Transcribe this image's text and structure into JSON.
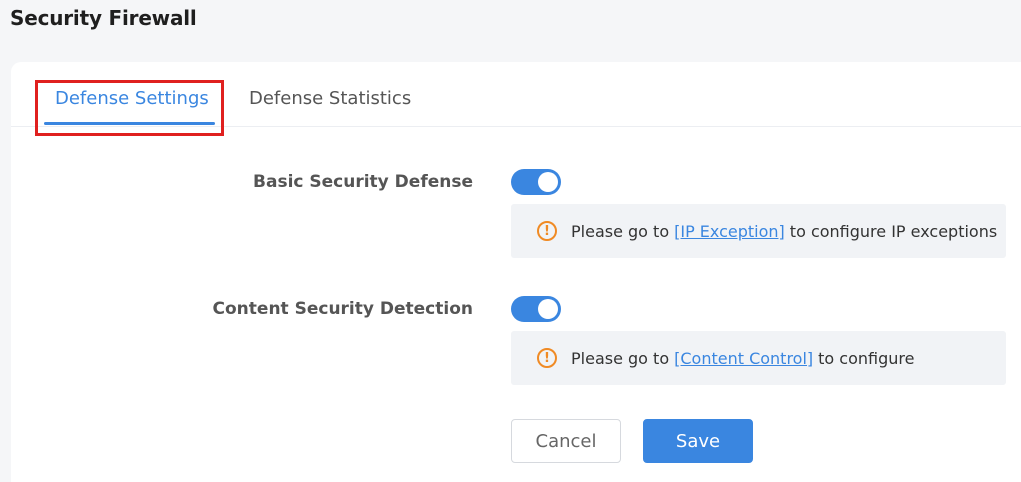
{
  "page": {
    "title": "Security Firewall"
  },
  "tabs": [
    {
      "label": "Defense Settings",
      "active": true
    },
    {
      "label": "Defense Statistics",
      "active": false
    }
  ],
  "settings": {
    "basic_security": {
      "label": "Basic Security Defense",
      "enabled": true,
      "notice_prefix": "Please go to",
      "notice_link": "[IP Exception]",
      "notice_suffix": "to configure IP exceptions"
    },
    "content_security": {
      "label": "Content Security Detection",
      "enabled": true,
      "notice_prefix": "Please go to",
      "notice_link": "[Content Control]",
      "notice_suffix": "to configure"
    }
  },
  "actions": {
    "cancel_label": "Cancel",
    "save_label": "Save"
  },
  "icons": {
    "notice_icon": "warning-circle-icon",
    "notice_glyph": "!"
  },
  "colors": {
    "accent": "#3a86e0",
    "highlight": "#e0201f",
    "warning": "#f08a24"
  }
}
